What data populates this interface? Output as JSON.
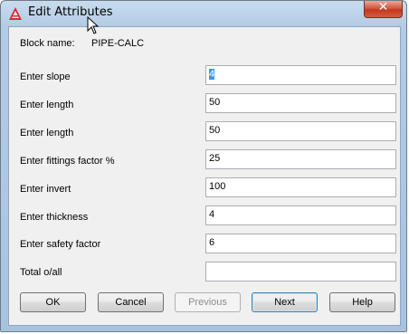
{
  "window": {
    "title": "Edit Attributes",
    "close_symbol": "✕"
  },
  "block": {
    "label": "Block name:",
    "value": "PIPE-CALC"
  },
  "fields": [
    {
      "label": "Enter slope",
      "value": "4",
      "selected": true
    },
    {
      "label": "Enter length",
      "value": "50"
    },
    {
      "label": "Enter length",
      "value": "50"
    },
    {
      "label": "Enter fittings factor %",
      "value": "25"
    },
    {
      "label": "Enter invert",
      "value": "100"
    },
    {
      "label": "Enter thickness",
      "value": "4"
    },
    {
      "label": "Enter safety factor",
      "value": "6"
    },
    {
      "label": "Total o/all",
      "value": ""
    }
  ],
  "buttons": {
    "ok": "OK",
    "cancel": "Cancel",
    "previous": "Previous",
    "next": "Next",
    "help": "Help"
  },
  "colors": {
    "app_icon": "#d8262d",
    "selection": "#3399ff",
    "close_button": "#c94a33"
  }
}
